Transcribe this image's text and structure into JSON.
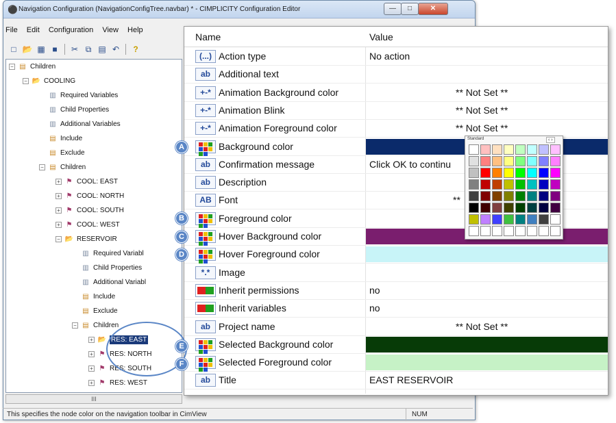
{
  "window": {
    "title": "Navigation Configuration (NavigationConfigTree.navbar) * - CIMPLICITY Configuration Editor",
    "min": "—",
    "max": "□",
    "close": "✕"
  },
  "menu": [
    "File",
    "Edit",
    "Configuration",
    "View",
    "Help"
  ],
  "toolbar_icons": [
    "new-icon",
    "open-icon",
    "properties-icon",
    "save-icon",
    "cut-icon",
    "copy-icon",
    "paste-icon",
    "undo-icon",
    "help-icon"
  ],
  "tree": [
    {
      "label": "Children",
      "icon": "db"
    },
    {
      "label": "COOLING",
      "icon": "folder"
    },
    {
      "label": "Required Variables",
      "icon": "var"
    },
    {
      "label": "Child Properties",
      "icon": "var"
    },
    {
      "label": "Additional Variables",
      "icon": "var"
    },
    {
      "label": "Include",
      "icon": "db"
    },
    {
      "label": "Exclude",
      "icon": "db"
    },
    {
      "label": "Children",
      "icon": "db"
    },
    {
      "label": "COOL: EAST",
      "icon": "nav"
    },
    {
      "label": "COOL: NORTH",
      "icon": "nav"
    },
    {
      "label": "COOL: SOUTH",
      "icon": "nav"
    },
    {
      "label": "COOL: WEST",
      "icon": "nav"
    },
    {
      "label": "RESERVOIR",
      "icon": "folder"
    },
    {
      "label": "Required Variabl",
      "icon": "var"
    },
    {
      "label": "Child Properties",
      "icon": "var"
    },
    {
      "label": "Additional Variabl",
      "icon": "var"
    },
    {
      "label": "Include",
      "icon": "db"
    },
    {
      "label": "Exclude",
      "icon": "db"
    },
    {
      "label": "Children",
      "icon": "db"
    },
    {
      "label": "RES: EAST",
      "icon": "folder"
    },
    {
      "label": "RES: NORTH",
      "icon": "nav"
    },
    {
      "label": "RES: SOUTH",
      "icon": "nav"
    },
    {
      "label": "RES: WEST",
      "icon": "nav"
    }
  ],
  "tree_scroll": "III",
  "status": {
    "message": "This specifies the node color on the navigation toolbar in CimView",
    "num": "NUM"
  },
  "grid": {
    "col_name": "Name",
    "col_value": "Value",
    "rows": [
      {
        "icon": "(...)",
        "icon_type": "text",
        "name": "Action type",
        "value": "No action"
      },
      {
        "icon": "ab",
        "icon_type": "text",
        "name": "Additional text",
        "value": ""
      },
      {
        "icon": "+-*",
        "icon_type": "text",
        "name": "Animation Background color",
        "value": "** Not Set **"
      },
      {
        "icon": "+-*",
        "icon_type": "text",
        "name": "Animation Blink",
        "value": "** Not Set **"
      },
      {
        "icon": "+-*",
        "icon_type": "text",
        "name": "Animation Foreground color",
        "value": "** Not Set **"
      },
      {
        "icon": "",
        "icon_type": "palette",
        "name": "Background color",
        "value": "",
        "swatch": "#0a2a6a"
      },
      {
        "icon": "ab",
        "icon_type": "text",
        "name": "Confirmation message",
        "value": "Click OK to continu"
      },
      {
        "icon": "ab",
        "icon_type": "text",
        "name": "Description",
        "value": ""
      },
      {
        "icon": "AB",
        "icon_type": "text",
        "name": "Font",
        "value": "**"
      },
      {
        "icon": "",
        "icon_type": "palette",
        "name": "Foreground color",
        "value": ""
      },
      {
        "icon": "",
        "icon_type": "palette",
        "name": "Hover Background color",
        "value": "",
        "swatch": "#7a1e6e"
      },
      {
        "icon": "",
        "icon_type": "palette",
        "name": "Hover Foreground color",
        "value": "",
        "swatch": "#c8f4f8"
      },
      {
        "icon": "*.*",
        "icon_type": "text",
        "name": "Image",
        "value": ""
      },
      {
        "icon": "",
        "icon_type": "toggle",
        "name": "Inherit permissions",
        "value": "no"
      },
      {
        "icon": "",
        "icon_type": "toggle",
        "name": "Inherit variables",
        "value": "no"
      },
      {
        "icon": "ab",
        "icon_type": "text",
        "name": "Project name",
        "value": "** Not Set **"
      },
      {
        "icon": "",
        "icon_type": "palette",
        "name": "Selected Background color",
        "value": "",
        "swatch": "#073b07"
      },
      {
        "icon": "",
        "icon_type": "palette",
        "name": "Selected Foreground color",
        "value": "",
        "swatch": "#c6f2c6"
      },
      {
        "icon": "ab",
        "icon_type": "text",
        "name": "Title",
        "value": "EAST RESERVOIR"
      }
    ]
  },
  "callouts": [
    "A",
    "B",
    "C",
    "D",
    "E",
    "F"
  ],
  "picker": {
    "label": "Standard",
    "arrows": "‹ ›",
    "colors": [
      "#ffffff",
      "#ffc0c0",
      "#ffe0c0",
      "#ffffc0",
      "#c0ffc0",
      "#c0ffff",
      "#c0c0ff",
      "#ffc0ff",
      "#e0e0e0",
      "#ff8080",
      "#ffc080",
      "#ffff80",
      "#80ff80",
      "#80ffff",
      "#8080ff",
      "#ff80ff",
      "#c0c0c0",
      "#ff0000",
      "#ff8000",
      "#ffff00",
      "#00ff00",
      "#00ffff",
      "#0000ff",
      "#ff00ff",
      "#808080",
      "#c00000",
      "#c04000",
      "#c0c000",
      "#00c000",
      "#00c0c0",
      "#0000c0",
      "#c000c0",
      "#404040",
      "#800000",
      "#804000",
      "#808000",
      "#008000",
      "#008080",
      "#000080",
      "#800080",
      "#000000",
      "#400000",
      "#804040",
      "#404000",
      "#004000",
      "#004040",
      "#000040",
      "#400040",
      "#c0c000",
      "#c080ff",
      "#4040ff",
      "#40c040",
      "#008080",
      "#4080c0",
      "#404040",
      "#ffffff",
      "#ffffff",
      "#ffffff",
      "#ffffff",
      "#ffffff",
      "#ffffff",
      "#ffffff",
      "#ffffff",
      "#ffffff"
    ]
  },
  "colors": {
    "selection": "#1a3a7a",
    "callout": "#5a86c6"
  }
}
